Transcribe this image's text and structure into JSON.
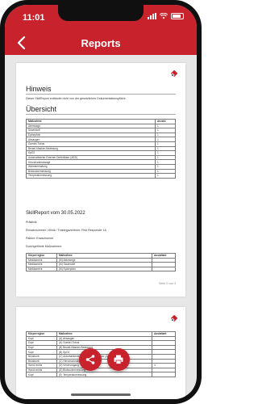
{
  "status": {
    "time": "11:01"
  },
  "header": {
    "title": "Reports"
  },
  "page1": {
    "heading1": "Hinweis",
    "note": "Dieser SkillReport entbindet nicht von der gesetzlichen Dokumentationspflicht.",
    "heading2": "Übersicht",
    "overview_headers": [
      "Maßnahme",
      "Anzahl"
    ],
    "overview_rows": [
      [
        "Atemwege",
        "1"
      ],
      [
        "Sauerstoff",
        "1"
      ],
      [
        "Epinephrin",
        "1"
      ],
      [
        "Absaugen",
        "1"
      ],
      [
        "Guedel-Tubus",
        "1"
      ],
      [
        "Beutel-Masken-Beatmung",
        "1"
      ],
      [
        "SpO2",
        "1"
      ],
      [
        "Automatisierter Externer Defibrillator (AED)",
        "1"
      ],
      [
        "Herzdruckmassage",
        "1"
      ],
      [
        "Wärmeerhaltung",
        "1"
      ],
      [
        "Blutzuckermessung",
        "1"
      ],
      [
        "Temperaturmessung",
        "1"
      ]
    ],
    "report_title": "SkillReport vom 30.05.2022",
    "line1": "Präklinik",
    "line2": "Einsatznummer / Klinik / Trainingszentrum: First Responder 1&",
    "line3": "Patient: Erwachsener",
    "line4": "Durchgeführte Maßnahmen:",
    "measures_headers": [
      "Körperregion",
      "Maßnahme",
      "Ausiatlant"
    ],
    "measures_rows": [
      [
        "Medikament",
        "(M) Atemwege",
        ""
      ],
      [
        "Medikament",
        "(M) Sauerstoff",
        ""
      ],
      [
        "Medikament",
        "(M) Epinephrin",
        ""
      ]
    ],
    "page_number": "Seite 2 von 3"
  },
  "page2": {
    "headers": [
      "Körperregion",
      "Maßnahme",
      "Ausiatlant"
    ],
    "rows": [
      [
        "Kopf",
        "(A) Absaugen",
        ""
      ],
      [
        "Kopf",
        "(A) Guedel-Tubus",
        ""
      ],
      [
        "Kopf",
        "(B) Beutel-Masken-Beatmung",
        ""
      ],
      [
        "Kopf",
        "(B) SpO2",
        ""
      ],
      [
        "Brustkorb",
        "(C) Automatisierter Externer Defibrillator (AED)",
        ""
      ],
      [
        "Brustkorb",
        "(C) Herzdruckmassage",
        ""
      ],
      [
        "Hand rechts",
        "(D) Venenzugang",
        "✕"
      ],
      [
        "Hand rechts",
        "(D) Blutzuckermessung",
        ""
      ],
      [
        "Kopf",
        "(E) Temperaturmessung",
        ""
      ]
    ]
  },
  "colors": {
    "brand": "#c8232c"
  }
}
